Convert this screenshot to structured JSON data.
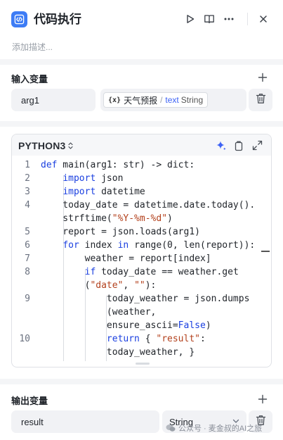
{
  "header": {
    "title": "代码执行",
    "description_placeholder": "添加描述..."
  },
  "inputs": {
    "section_title": "输入变量",
    "variables": [
      {
        "name": "arg1",
        "source_label": "天气预报",
        "source_type": "text",
        "source_type_name": "String"
      }
    ]
  },
  "code": {
    "language": "PYTHON3",
    "lines": [
      {
        "num": "1",
        "html": "<span class='kw'>def</span> main(arg1: str) -&gt; dict:"
      },
      {
        "num": "2",
        "html": "    <span class='kw'>import</span> json"
      },
      {
        "num": "3",
        "html": "    <span class='kw'>import</span> datetime"
      },
      {
        "num": "4",
        "html": "    today_date = datetime.date.today()."
      },
      {
        "num": "",
        "html": "    strftime(<span class='st'>\"%Y-%m-%d\"</span>)"
      },
      {
        "num": "5",
        "html": "    report = json.loads(arg1)"
      },
      {
        "num": "6",
        "html": "    <span class='kw'>for</span> index <span class='kw'>in</span> range(0, len(report)):"
      },
      {
        "num": "7",
        "html": "        weather = report[index]"
      },
      {
        "num": "8",
        "html": "        <span class='kw'>if</span> today_date == weather.get"
      },
      {
        "num": "",
        "html": "        (<span class='st'>\"date\"</span>, <span class='st'>\"\"</span>):"
      },
      {
        "num": "9",
        "html": "            today_weather = json.dumps"
      },
      {
        "num": "",
        "html": "            (weather,"
      },
      {
        "num": "",
        "html": "            ensure_ascii=<span class='kw'>False</span>)"
      },
      {
        "num": "10",
        "html": "            <span class='kw'>return</span> { <span class='st'>\"result\"</span>:"
      },
      {
        "num": "",
        "html": "            today_weather, }"
      }
    ]
  },
  "outputs": {
    "section_title": "输出变量",
    "variables": [
      {
        "name": "result",
        "type": "String"
      }
    ]
  },
  "watermark": "公众号 · 麦金叔的AI之旅",
  "colors": {
    "accent": "#3d7cf5",
    "keyword": "#1a3fe0",
    "string": "#b3411d"
  }
}
